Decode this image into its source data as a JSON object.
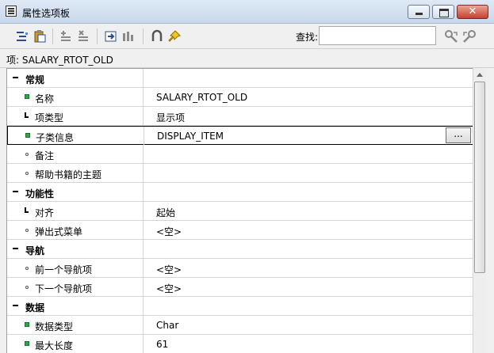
{
  "window": {
    "title": "属性选项板",
    "close_glyph": "✕"
  },
  "toolbar": {
    "icons": [
      "copy-properties-icon",
      "paste-properties-icon",
      "add-property-icon",
      "delete-property-icon",
      "inherit-icon",
      "property-class-icon",
      "union-icon",
      "pin-icon"
    ],
    "find_label": "查找:",
    "find_value": "",
    "search_icons": [
      "search-next-icon",
      "search-prev-icon"
    ]
  },
  "item": {
    "label": "项: SALARY_RTOT_OLD"
  },
  "properties": {
    "general": {
      "label": "常规",
      "name_label": "名称",
      "name_value": "SALARY_RTOT_OLD",
      "item_type_label": "项类型",
      "item_type_value": "显示项",
      "subclass_label": "子类信息",
      "subclass_value": "DISPLAY_ITEM",
      "ellipsis": "...",
      "comments_label": "备注",
      "help_topic_label": "帮助书籍的主题"
    },
    "functional": {
      "label": "功能性",
      "justification_label": "对齐",
      "justification_value": "起始",
      "popup_menu_label": "弹出式菜单",
      "popup_menu_value": "<空>"
    },
    "navigation": {
      "label": "导航",
      "prev_item_label": "前一个导航项",
      "prev_item_value": "<空>",
      "next_item_label": "下一个导航项",
      "next_item_value": "<空>"
    },
    "data": {
      "label": "数据",
      "datatype_label": "数据类型",
      "datatype_value": "Char",
      "max_length_label": "最大长度",
      "max_length_value": "61"
    }
  },
  "colors": {
    "accent_green": "#2aa84a",
    "close_red": "#c7412e"
  }
}
